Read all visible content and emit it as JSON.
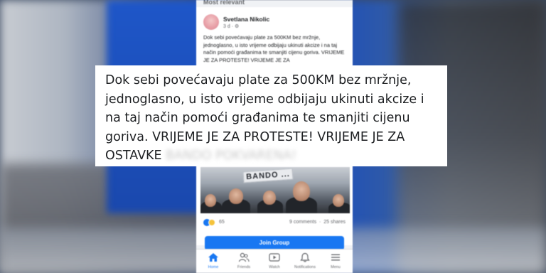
{
  "feed": {
    "sort_label": "Most relevant"
  },
  "post": {
    "author": "Svetlana Nikolic",
    "meta": "3 d · ⚙",
    "text": "Dok sebi povećavaju plate za 500KM bez mržnje, jednoglasno, u isto vrijeme odbijaju ukinuti akcize i na taj način pomoći građanima te smanjiti cijenu goriva. VRIJEME JE ZA PROTESTE! VRIJEME JE ZA",
    "photo_banner": "BANDO ...",
    "reactions_count": "65",
    "comments": "9 comments",
    "shares": "25 shares",
    "join_button": "Join Group"
  },
  "bottom_nav": [
    {
      "label": "Home",
      "icon": "home-icon"
    },
    {
      "label": "Friends",
      "icon": "friends-icon"
    },
    {
      "label": "Watch",
      "icon": "watch-icon"
    },
    {
      "label": "Notifications",
      "icon": "bell-icon"
    },
    {
      "label": "Menu",
      "icon": "menu-icon"
    }
  ],
  "caption": {
    "text": "Dok sebi povećavaju plate za 500KM bez mržnje, jednoglasno, u isto vrijeme odbijaju ukinuti akcize i na taj način pomoći građanima te smanjiti cijenu goriva. VRIJEME JE ZA PROTESTE! VRIJEME JE ZA OSTAVKE",
    "faded_text": "BANDO POKVARENA!"
  },
  "colors": {
    "facebook_blue": "#1877f2",
    "caption_bg": "#ffffff",
    "text": "#1d1f22"
  }
}
